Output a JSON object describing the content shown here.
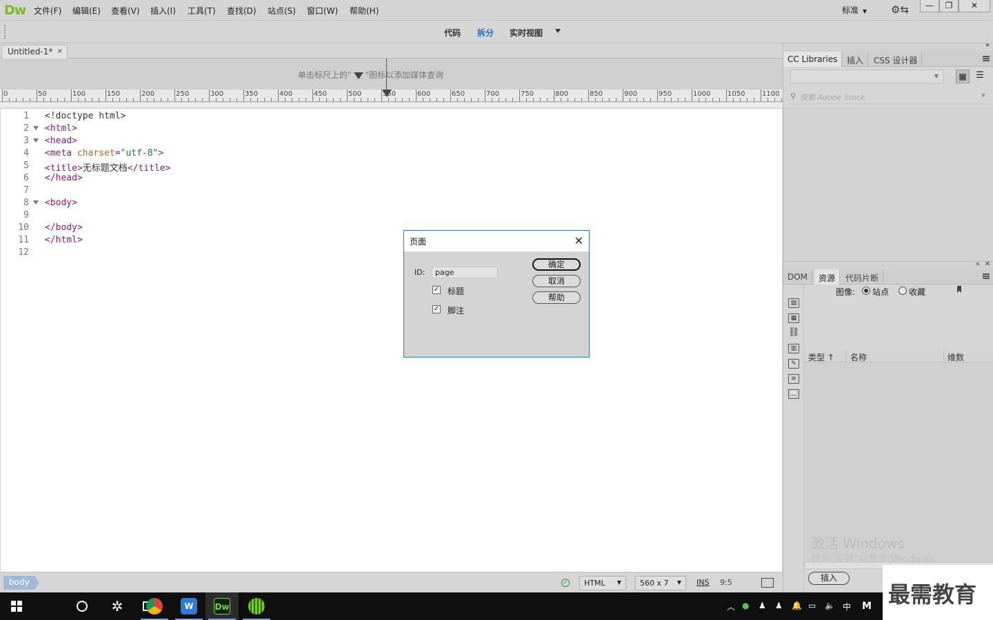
{
  "app": {
    "logo": "Dw",
    "menu": [
      "文件(F)",
      "编辑(E)",
      "查看(V)",
      "插入(I)",
      "工具(T)",
      "查找(D)",
      "站点(S)",
      "窗口(W)",
      "帮助(H)"
    ],
    "workspace": "标准",
    "window_buttons": {
      "minimize": "—",
      "restore": "❐",
      "close": "✕"
    }
  },
  "view_toolbar": {
    "code": "代码",
    "split": "拆分",
    "live": "实时视图",
    "active": "split"
  },
  "document": {
    "tab_title": "Untitled-1*",
    "tab_close": "×"
  },
  "media_query_hint": {
    "before": "单击标尺上的\"",
    "after": "\"图标以添加媒体查询"
  },
  "ruler": {
    "labels": [
      "0",
      "50",
      "100",
      "150",
      "200",
      "250",
      "300",
      "350",
      "400",
      "450",
      "500",
      "550",
      "600",
      "650",
      "700",
      "750",
      "800",
      "850",
      "900",
      "950",
      "1000",
      "1050",
      "1100"
    ]
  },
  "code": {
    "lines": [
      {
        "num": "1",
        "fold": false,
        "parts": [
          {
            "t": "<!doctype html>",
            "c": "doctype"
          }
        ]
      },
      {
        "num": "2",
        "fold": true,
        "parts": [
          {
            "t": "<html>",
            "c": "tag"
          }
        ]
      },
      {
        "num": "3",
        "fold": true,
        "parts": [
          {
            "t": "<head>",
            "c": "tag"
          }
        ]
      },
      {
        "num": "4",
        "fold": false,
        "parts": [
          {
            "t": "<meta ",
            "c": "tag"
          },
          {
            "t": "charset",
            "c": "attr"
          },
          {
            "t": "=",
            "c": "tag"
          },
          {
            "t": "\"utf-8\"",
            "c": "val"
          },
          {
            "t": ">",
            "c": "tag"
          }
        ]
      },
      {
        "num": "5",
        "fold": false,
        "parts": [
          {
            "t": "<title>",
            "c": "tag"
          },
          {
            "t": "无标题文档",
            "c": "doctype"
          },
          {
            "t": "</title>",
            "c": "tag"
          }
        ]
      },
      {
        "num": "6",
        "fold": false,
        "parts": [
          {
            "t": "</head>",
            "c": "tag"
          }
        ]
      },
      {
        "num": "7",
        "fold": false,
        "parts": []
      },
      {
        "num": "8",
        "fold": true,
        "parts": [
          {
            "t": "<body>",
            "c": "tag"
          }
        ]
      },
      {
        "num": "9",
        "fold": false,
        "parts": []
      },
      {
        "num": "10",
        "fold": false,
        "parts": [
          {
            "t": "</body>",
            "c": "tag"
          }
        ]
      },
      {
        "num": "11",
        "fold": false,
        "parts": [
          {
            "t": "</html>",
            "c": "tag"
          }
        ]
      },
      {
        "num": "12",
        "fold": false,
        "parts": []
      }
    ]
  },
  "status": {
    "tag_selector": "body",
    "doc_type": "HTML",
    "window_size": "560 x 7",
    "ins": "INS",
    "cursor_pos": "9:5"
  },
  "panels": {
    "top_tabs": [
      "CC Libraries",
      "插入",
      "CSS 设计器"
    ],
    "stock_search_placeholder": "搜索 Adobe Stock",
    "bottom_tabs": [
      "DOM",
      "资源",
      "代码片断"
    ],
    "active_bottom_tab": "资源",
    "assets": {
      "image_label": "图像:",
      "radio_site": "站点",
      "radio_favorites": "收藏",
      "selected": "site",
      "columns": [
        "类型 ↑",
        "名称",
        "维数"
      ],
      "insert_button": "插入",
      "watermark_line1": "激活 Windows",
      "watermark_line2": "转到\"设置\"以激活 Windows。"
    }
  },
  "dialog": {
    "title": "页面",
    "id_label": "ID:",
    "id_value": "page",
    "checkbox_title": "标题",
    "checkbox_title_checked": true,
    "checkbox_footer": "脚注",
    "checkbox_footer_checked": true,
    "ok": "确定",
    "cancel": "取消",
    "help": "帮助"
  },
  "taskbar": {
    "tray_ime": "中",
    "tray_m": "M"
  },
  "brand_watermark": "最需教育"
}
